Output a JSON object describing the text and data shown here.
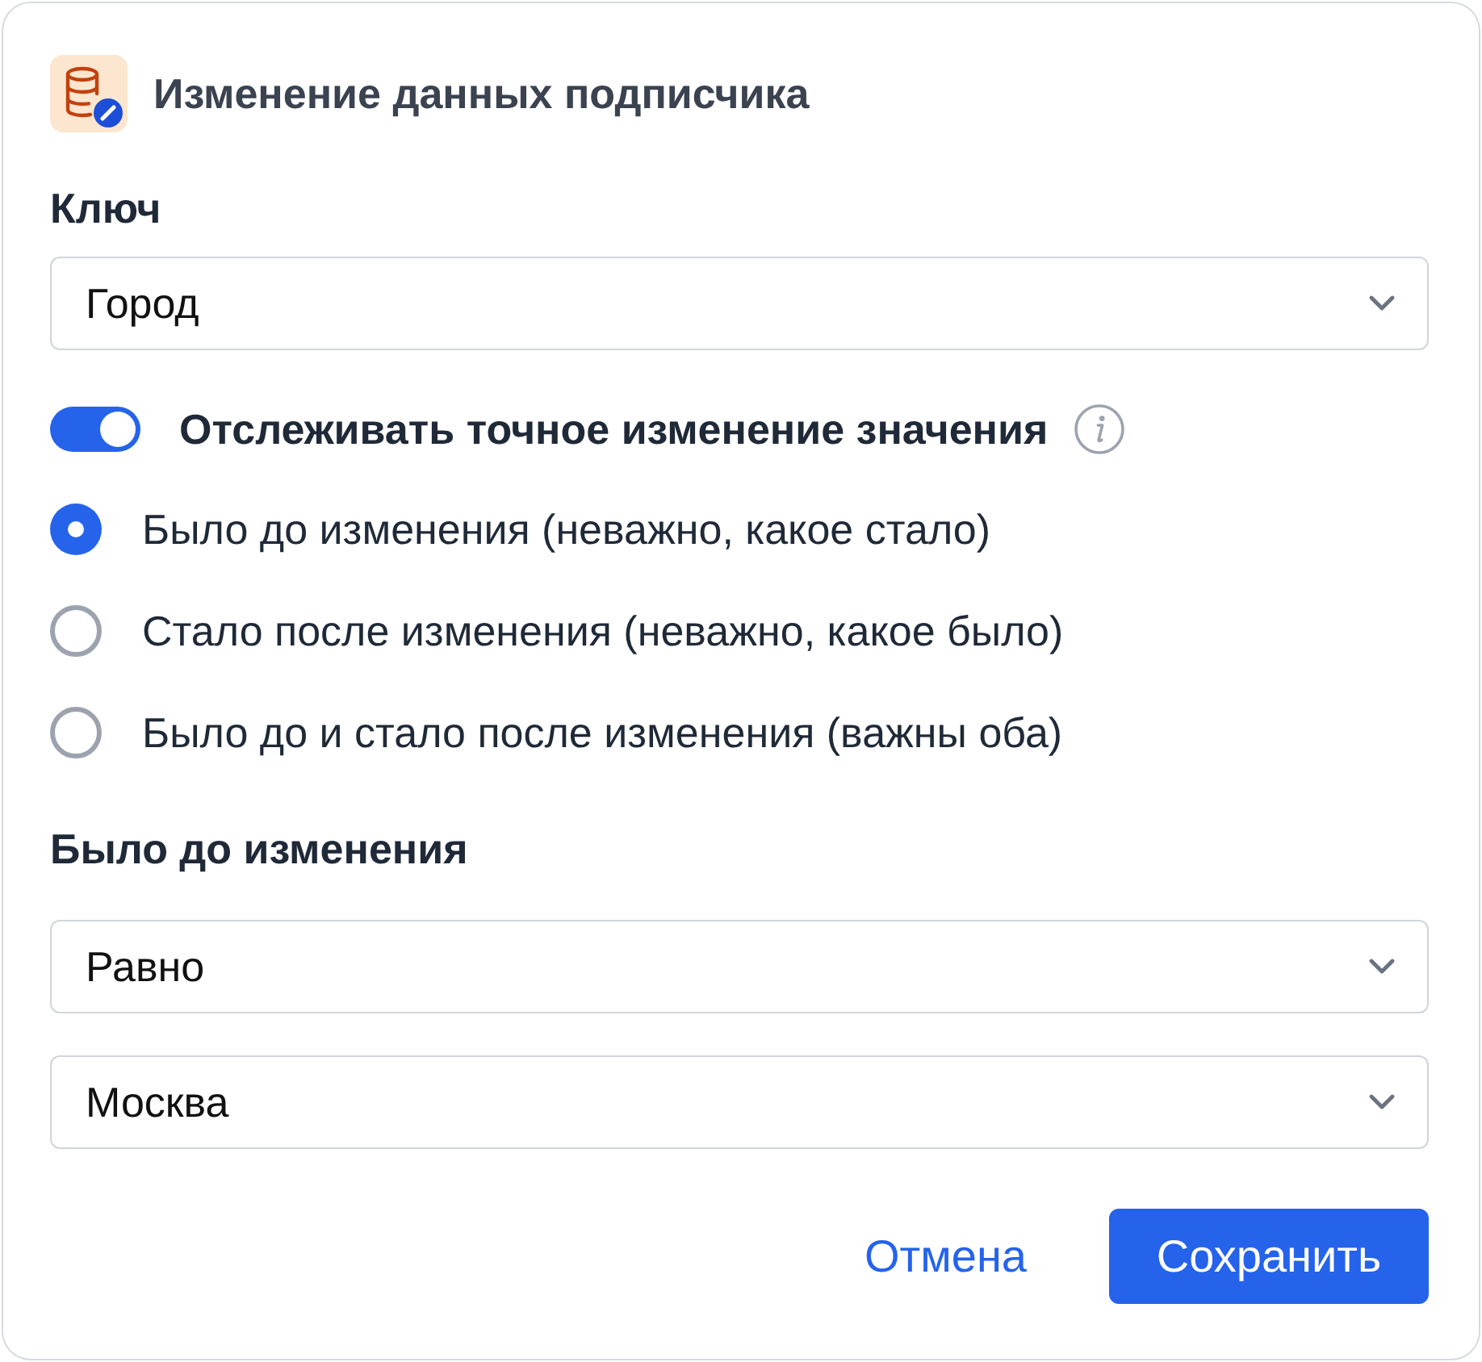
{
  "dialog": {
    "title": "Изменение данных подписчика"
  },
  "key_field": {
    "label": "Ключ",
    "value": "Город"
  },
  "track_toggle": {
    "label": "Отслеживать точное изменение значения",
    "on": true
  },
  "options": [
    {
      "label": "Было до изменения (неважно, какое стало)",
      "selected": true
    },
    {
      "label": "Стало после изменения (неважно, какое было)",
      "selected": false
    },
    {
      "label": "Было до и стало после изменения (важны оба)",
      "selected": false
    }
  ],
  "condition": {
    "label": "Было до изменения",
    "operator": "Равно",
    "value": "Москва"
  },
  "buttons": [
    {
      "label": "Отмена",
      "kind": "link"
    },
    {
      "label": "Сохранить",
      "kind": "primary"
    }
  ]
}
